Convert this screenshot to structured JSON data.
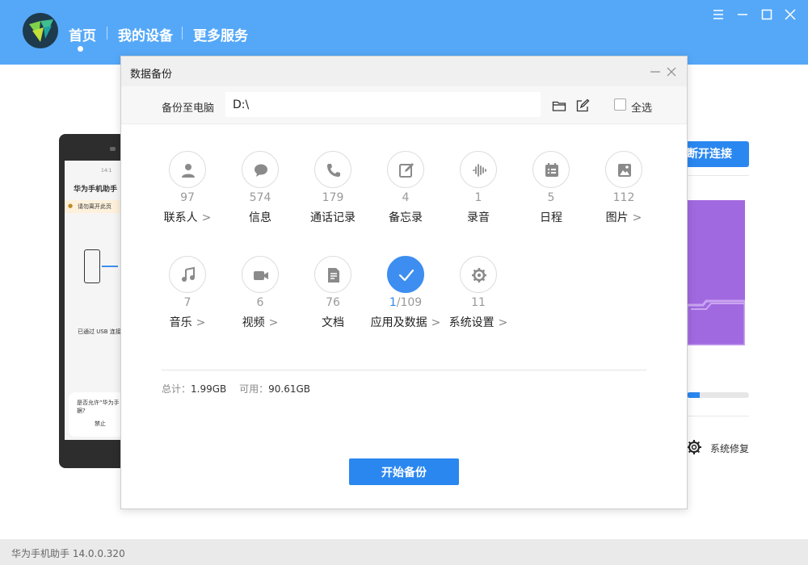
{
  "header": {
    "nav": [
      "首页",
      "我的设备",
      "更多服务"
    ],
    "active_nav": 0
  },
  "window_controls": [
    "menu-icon",
    "minimize-icon",
    "maximize-icon",
    "close-icon"
  ],
  "background": {
    "phone": {
      "time": "14:1",
      "app_title": "华为手机助手",
      "notice": "请勿离开此页",
      "usb_text": "已通过 USB 连接",
      "prompt": "是否允许“华为手",
      "prompt_line2": "据?",
      "deny": "禁止"
    },
    "disconnect_button": "断开连接",
    "storage_fraction": 0.21,
    "system_repair": "系统修复"
  },
  "dialog": {
    "title": "数据备份",
    "path_label": "备份至电脑",
    "path_value": "D:\\",
    "select_all": "全选",
    "items": [
      {
        "label": "联系人",
        "count": "97",
        "arrow": true,
        "icon": "contact-icon"
      },
      {
        "label": "信息",
        "count": "574",
        "arrow": false,
        "icon": "message-icon"
      },
      {
        "label": "通话记录",
        "count": "179",
        "arrow": false,
        "icon": "phone-icon"
      },
      {
        "label": "备忘录",
        "count": "4",
        "arrow": false,
        "icon": "memo-icon"
      },
      {
        "label": "录音",
        "count": "1",
        "arrow": false,
        "icon": "recording-icon"
      },
      {
        "label": "日程",
        "count": "5",
        "arrow": false,
        "icon": "calendar-icon"
      },
      {
        "label": "图片",
        "count": "112",
        "arrow": true,
        "icon": "picture-icon"
      },
      {
        "label": "音乐",
        "count": "7",
        "arrow": true,
        "icon": "music-icon"
      },
      {
        "label": "视频",
        "count": "6",
        "arrow": true,
        "icon": "video-icon"
      },
      {
        "label": "文档",
        "count": "76",
        "arrow": false,
        "icon": "document-icon"
      },
      {
        "label": "应用及数据",
        "count_selected": "1",
        "count_total": "/109",
        "arrow": true,
        "checked": true,
        "icon": "check-icon"
      },
      {
        "label": "系统设置",
        "count": "11",
        "arrow": true,
        "icon": "settings-icon"
      }
    ],
    "arrow_glyph": ">",
    "stats": {
      "total_label": "总计：",
      "total_value": "1.99GB",
      "free_label": "可用：",
      "free_value": "90.61GB"
    },
    "start_button": "开始备份"
  },
  "status_bar": {
    "version_text": "华为手机助手 14.0.0.320"
  },
  "colors": {
    "header_blue": "#55a8f8",
    "accent_blue": "#2a87f0",
    "check_blue": "#3d8ef0",
    "purple_card": "#a169e0"
  }
}
